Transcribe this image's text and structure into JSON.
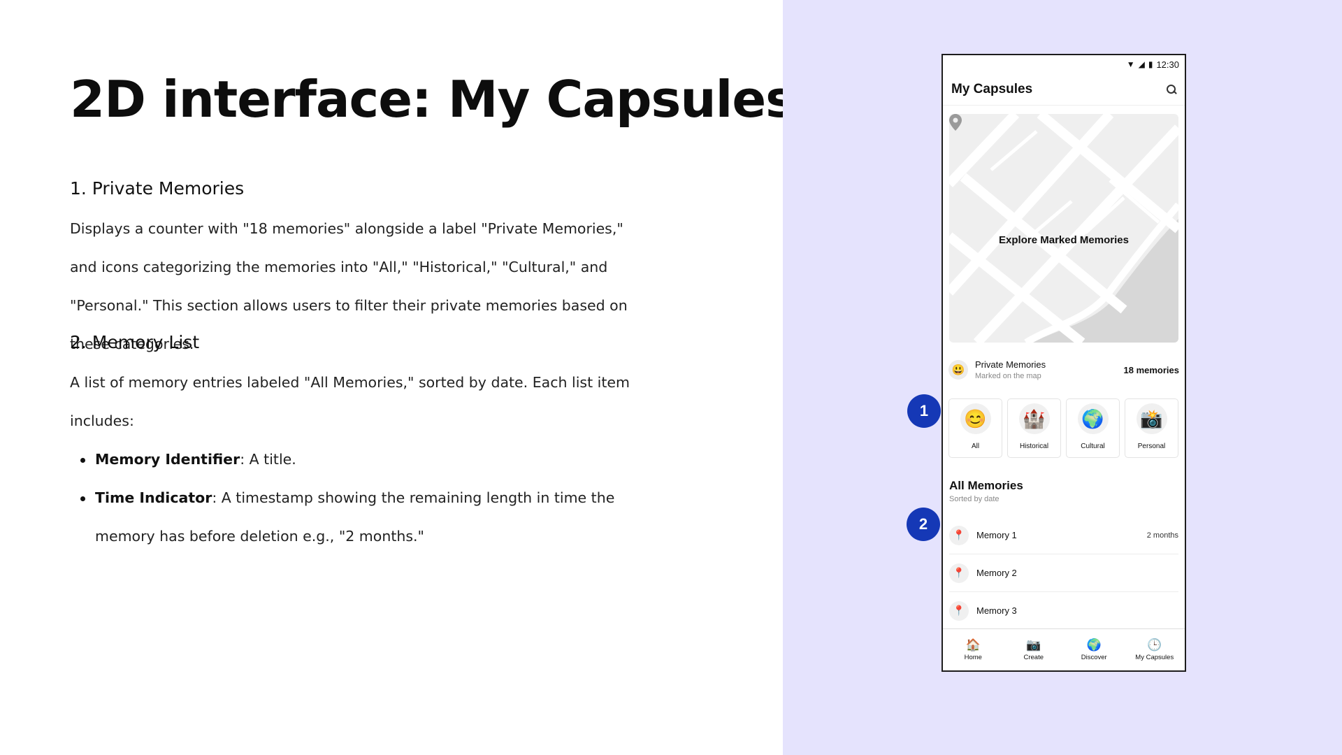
{
  "slide": {
    "title": "2D interface: My Capsules",
    "section1": {
      "heading": "1. Private Memories",
      "text": "Displays a counter with \"18 memories\" alongside a label \"Private Memories,\" and icons categorizing the memories into \"All,\" \"Historical,\" \"Cultural,\" and \"Personal.\" This section allows users to filter their private memories based on these categories."
    },
    "section2": {
      "heading": "2. Memory List",
      "text": "A list of memory entries labeled \"All Memories,\" sorted by date. Each list item includes:",
      "bullets": [
        {
          "term": "Memory Identifier",
          "desc": ": A title."
        },
        {
          "term": "Time Indicator",
          "desc": ": A timestamp showing the remaining length in time the memory has before deletion e.g., \"2 months.\""
        }
      ]
    }
  },
  "callouts": [
    "1",
    "2"
  ],
  "phone": {
    "status_time": "12:30",
    "app_title": "My Capsules",
    "map_label": "Explore Marked Memories",
    "private": {
      "title": "Private Memories",
      "subtitle": "Marked on the map",
      "count": "18 memories"
    },
    "categories": [
      {
        "label": "All",
        "icon": "😊"
      },
      {
        "label": "Historical",
        "icon": "🏰"
      },
      {
        "label": "Cultural",
        "icon": "🌍"
      },
      {
        "label": "Personal",
        "icon": "📸"
      }
    ],
    "list": {
      "title": "All Memories",
      "subtitle": "Sorted by date",
      "items": [
        {
          "name": "Memory 1",
          "time": "2 months"
        },
        {
          "name": "Memory 2",
          "time": ""
        },
        {
          "name": "Memory 3",
          "time": ""
        }
      ]
    },
    "nav": [
      {
        "label": "Home",
        "icon": "🏠"
      },
      {
        "label": "Create",
        "icon": "📷"
      },
      {
        "label": "Discover",
        "icon": "🌍"
      },
      {
        "label": "My Capsules",
        "icon": "🕒"
      }
    ]
  },
  "colors": {
    "panel_bg": "#e5e3fd",
    "callout": "#1538b6"
  }
}
